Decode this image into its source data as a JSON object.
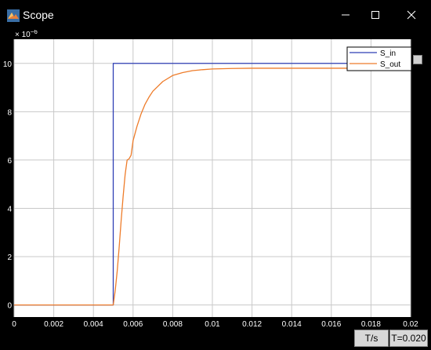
{
  "window": {
    "title": "Scope",
    "minimize_icon": "minimize-icon",
    "maximize_icon": "maximize-icon",
    "close_icon": "close-icon"
  },
  "status": {
    "sample_time_label": "T/s",
    "time_readout": "T=0.020"
  },
  "colors": {
    "s_in": "#2f3fb5",
    "s_out": "#ee7c2a",
    "grid": "#c8c8c8",
    "background": "#ffffff",
    "frame": "#000000"
  },
  "chart_data": {
    "type": "line",
    "exponent_label": "× 10",
    "exponent_power": "−6",
    "xlim": [
      0,
      0.02
    ],
    "ylim": [
      -0.5,
      11
    ],
    "x_ticks": [
      0,
      0.002,
      0.004,
      0.006,
      0.008,
      0.01,
      0.012,
      0.014,
      0.016,
      0.018,
      0.02
    ],
    "x_tick_labels": [
      "0",
      "0.002",
      "0.004",
      "0.006",
      "0.008",
      "0.01",
      "0.012",
      "0.014",
      "0.016",
      "0.018",
      "0.02"
    ],
    "y_ticks": [
      0,
      2,
      4,
      6,
      8,
      10
    ],
    "y_tick_labels": [
      "0",
      "2",
      "4",
      "6",
      "8",
      "10"
    ],
    "grid": true,
    "legend_position": "top-right",
    "series": [
      {
        "name": "S_in",
        "color": "#2f3fb5",
        "x": [
          0,
          0.005,
          0.005,
          0.02
        ],
        "y": [
          0,
          0,
          10,
          10
        ]
      },
      {
        "name": "S_out",
        "color": "#ee7c2a",
        "x": [
          0,
          0.005,
          0.0051,
          0.0052,
          0.0053,
          0.0054,
          0.0055,
          0.0056,
          0.0057,
          0.0058,
          0.0059,
          0.006,
          0.0062,
          0.0064,
          0.0066,
          0.0068,
          0.007,
          0.0075,
          0.008,
          0.0085,
          0.009,
          0.0095,
          0.01,
          0.011,
          0.012,
          0.014,
          0.016,
          0.018,
          0.02
        ],
        "y": [
          0,
          0,
          0.6,
          1.4,
          2.4,
          3.5,
          4.5,
          5.4,
          6.0,
          6.05,
          6.2,
          6.8,
          7.4,
          7.9,
          8.3,
          8.6,
          8.85,
          9.25,
          9.5,
          9.62,
          9.7,
          9.74,
          9.77,
          9.79,
          9.8,
          9.8,
          9.8,
          9.8,
          9.8
        ]
      }
    ]
  }
}
